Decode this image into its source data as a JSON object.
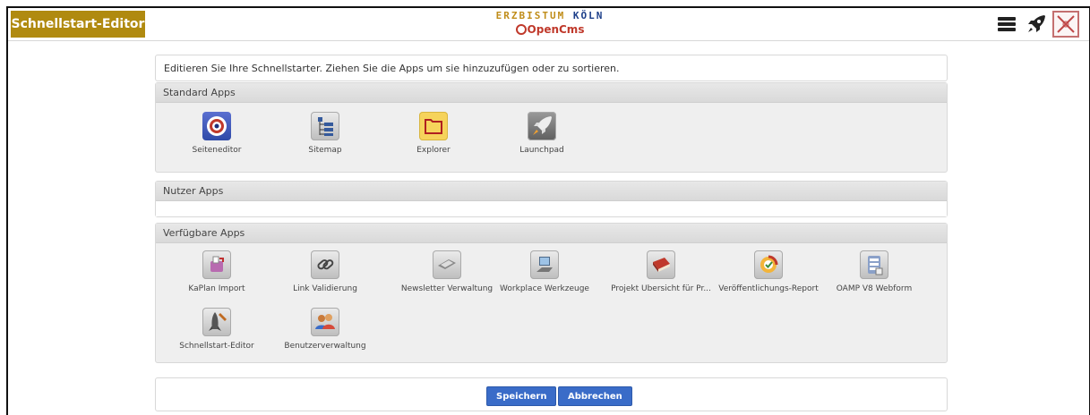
{
  "header": {
    "title": "Schnellstart-Editor",
    "brand_top_a": "ERZBISTUM",
    "brand_top_b": "KÖLN",
    "brand_bottom": "OpenCms"
  },
  "intro_text": "Editieren Sie Ihre Schnellstarter. Ziehen Sie die Apps um sie hinzuzufügen oder zu sortieren.",
  "groups": [
    {
      "title": "Standard Apps",
      "apps": [
        {
          "label": "Seiteneditor",
          "icon": "target-icon"
        },
        {
          "label": "Sitemap",
          "icon": "sitemap-icon"
        },
        {
          "label": "Explorer",
          "icon": "folder-icon"
        },
        {
          "label": "Launchpad",
          "icon": "rocket-icon"
        }
      ]
    },
    {
      "title": "Nutzer Apps",
      "apps": []
    },
    {
      "title": "Verfügbare Apps",
      "apps": [
        {
          "label": "KaPlan Import",
          "icon": "mailbox-icon"
        },
        {
          "label": "Link Validierung",
          "icon": "chain-link-icon"
        },
        {
          "label": "Newsletter Verwaltung",
          "icon": "newsletter-icon"
        },
        {
          "label": "Workplace Werkzeuge",
          "icon": "computer-icon"
        },
        {
          "label": "Projekt Übersicht für Pr...",
          "icon": "book-icon"
        },
        {
          "label": "Veröffentlichungs-Report",
          "icon": "publish-report-icon"
        },
        {
          "label": "OAMP V8 Webform",
          "icon": "database-form-icon"
        },
        {
          "label": "Schnellstart-Editor",
          "icon": "rocket-editor-icon"
        },
        {
          "label": "Benutzerverwaltung",
          "icon": "users-icon"
        }
      ]
    }
  ],
  "buttons": {
    "save": "Speichern",
    "cancel": "Abbrechen"
  },
  "colors": {
    "title_badge": "#b08a10",
    "button": "#3a6cc8",
    "brand_gold": "#c08d1a",
    "brand_blue": "#1d3f8a",
    "brand_red": "#c0392b"
  }
}
